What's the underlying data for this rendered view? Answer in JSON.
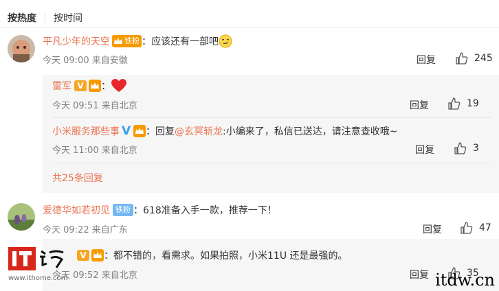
{
  "sort_tabs": [
    "按热度",
    "按时间"
  ],
  "comments": [
    {
      "user": "平凡少年的天空",
      "fan_badge": "铁粉",
      "text": "：应该还有一部吧",
      "emoji": "smirk-emoji",
      "time": "今天 09:00",
      "from": "来自安徽",
      "reply_label": "回复",
      "likes": "245"
    },
    {
      "user": "爱德华如若初见",
      "fan_badge": "铁粉",
      "text": "：618准备入手一款，推荐一下！",
      "time": "今天 09:22",
      "from": "来自广东",
      "reply_label": "回复",
      "likes": "47"
    }
  ],
  "replies": [
    {
      "user": "雷军",
      "badge": "V",
      "text": "：",
      "emoji": "heart-emoji",
      "time": "今天 09:51",
      "from": "来自北京",
      "reply_label": "回复",
      "likes": "19"
    },
    {
      "user": "小米服务那些事",
      "badge": "V",
      "reply_prefix": "：回复",
      "mention": "@玄冥斩龙",
      "text": ":小编来了，私信已送达，请注意查收哦~",
      "time": "今天 11:00",
      "from": "来自北京",
      "reply_label": "回复",
      "likes": "3"
    },
    {
      "badge": "V",
      "text": "：都不错的，看需求。如果拍照，小米11U 还是最强的。",
      "time": "今天 09:52",
      "from": "来自北京",
      "reply_label": "回复",
      "likes": "35"
    }
  ],
  "more_replies": "共25条回复",
  "watermark": {
    "logo": "IT之家",
    "url": "www.ithome.com"
  },
  "site_mark": "itdw.cn",
  "colors": {
    "accent": "#eb7350",
    "fan_badge": "#f79a00",
    "fan_badge_blue": "#74b7f3",
    "verified_orange": "#f5a623",
    "verified_blue": "#3d9df2",
    "reply_bg": "#f6f6f6"
  }
}
